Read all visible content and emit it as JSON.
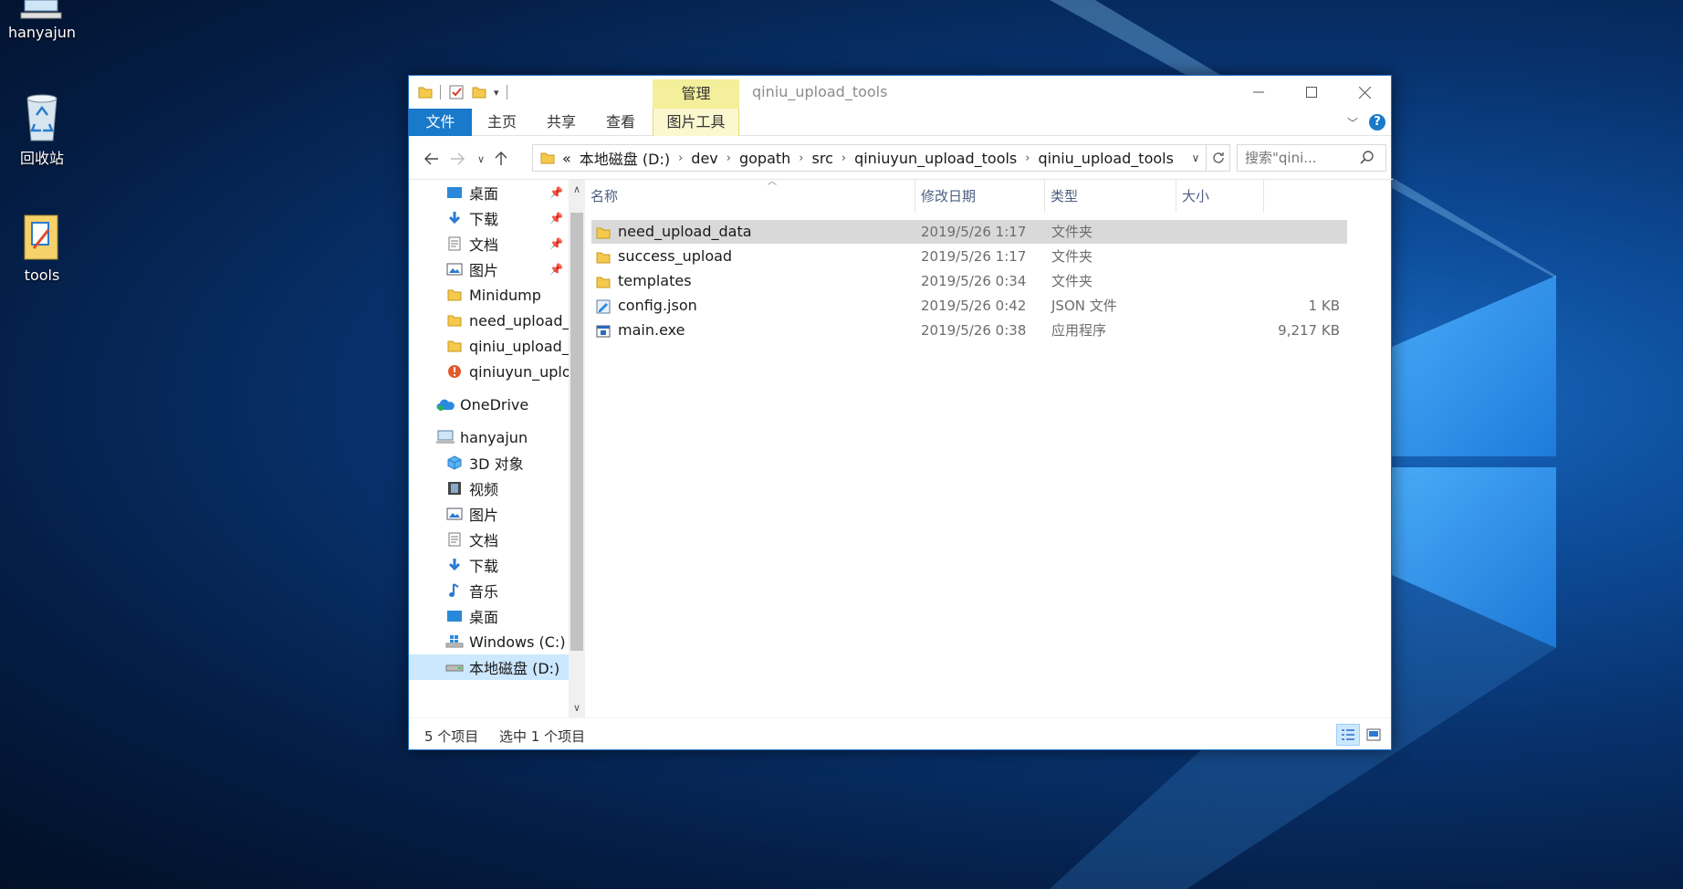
{
  "desktop": {
    "icons": [
      {
        "label": "hanyajun"
      },
      {
        "label": "回收站"
      },
      {
        "label": "tools"
      }
    ]
  },
  "window": {
    "title": "qiniu_upload_tools",
    "context_tab_group": "管理",
    "ribbon_tabs": [
      "文件",
      "主页",
      "共享",
      "查看",
      "图片工具"
    ],
    "address": {
      "overflow": "«",
      "crumbs": [
        "本地磁盘 (D:)",
        "dev",
        "gopath",
        "src",
        "qiniuyun_upload_tools",
        "qiniu_upload_tools"
      ]
    },
    "search_placeholder": "搜索\"qini...",
    "nav": {
      "quick_access": [
        {
          "label": "桌面",
          "icon": "desktop-icon",
          "pinned": true
        },
        {
          "label": "下载",
          "icon": "download-icon",
          "pinned": true
        },
        {
          "label": "文档",
          "icon": "document-icon",
          "pinned": true
        },
        {
          "label": "图片",
          "icon": "picture-icon",
          "pinned": true
        },
        {
          "label": "Minidump",
          "icon": "folder-icon",
          "pinned": false
        },
        {
          "label": "need_upload_d",
          "icon": "folder-icon",
          "pinned": false
        },
        {
          "label": "qiniu_upload_t",
          "icon": "folder-icon",
          "pinned": false
        },
        {
          "label": "qiniuyun_uploa",
          "icon": "go-folder-icon",
          "pinned": false
        }
      ],
      "onedrive": "OneDrive",
      "this_pc": "hanyajun",
      "pc_items": [
        {
          "label": "3D 对象",
          "icon": "3d-objects-icon"
        },
        {
          "label": "视频",
          "icon": "video-icon"
        },
        {
          "label": "图片",
          "icon": "picture-icon"
        },
        {
          "label": "文档",
          "icon": "document-icon"
        },
        {
          "label": "下载",
          "icon": "download-icon"
        },
        {
          "label": "音乐",
          "icon": "music-icon"
        },
        {
          "label": "桌面",
          "icon": "desktop-icon"
        },
        {
          "label": "Windows (C:)",
          "icon": "windows-drive-icon"
        },
        {
          "label": "本地磁盘 (D:)",
          "icon": "drive-icon",
          "selected": true
        }
      ]
    },
    "columns": [
      "名称",
      "修改日期",
      "类型",
      "大小"
    ],
    "files": [
      {
        "name": "need_upload_data",
        "date": "2019/5/26 1:17",
        "type": "文件夹",
        "size": "",
        "icon": "folder-icon",
        "selected": true
      },
      {
        "name": "success_upload",
        "date": "2019/5/26 1:17",
        "type": "文件夹",
        "size": "",
        "icon": "folder-icon",
        "selected": false
      },
      {
        "name": "templates",
        "date": "2019/5/26 0:34",
        "type": "文件夹",
        "size": "",
        "icon": "folder-icon",
        "selected": false
      },
      {
        "name": "config.json",
        "date": "2019/5/26 0:42",
        "type": "JSON 文件",
        "size": "1 KB",
        "icon": "json-file-icon",
        "selected": false
      },
      {
        "name": "main.exe",
        "date": "2019/5/26 0:38",
        "type": "应用程序",
        "size": "9,217 KB",
        "icon": "exe-file-icon",
        "selected": false
      }
    ],
    "status": {
      "item_count": "5 个项目",
      "selection": "选中 1 个项目"
    }
  }
}
